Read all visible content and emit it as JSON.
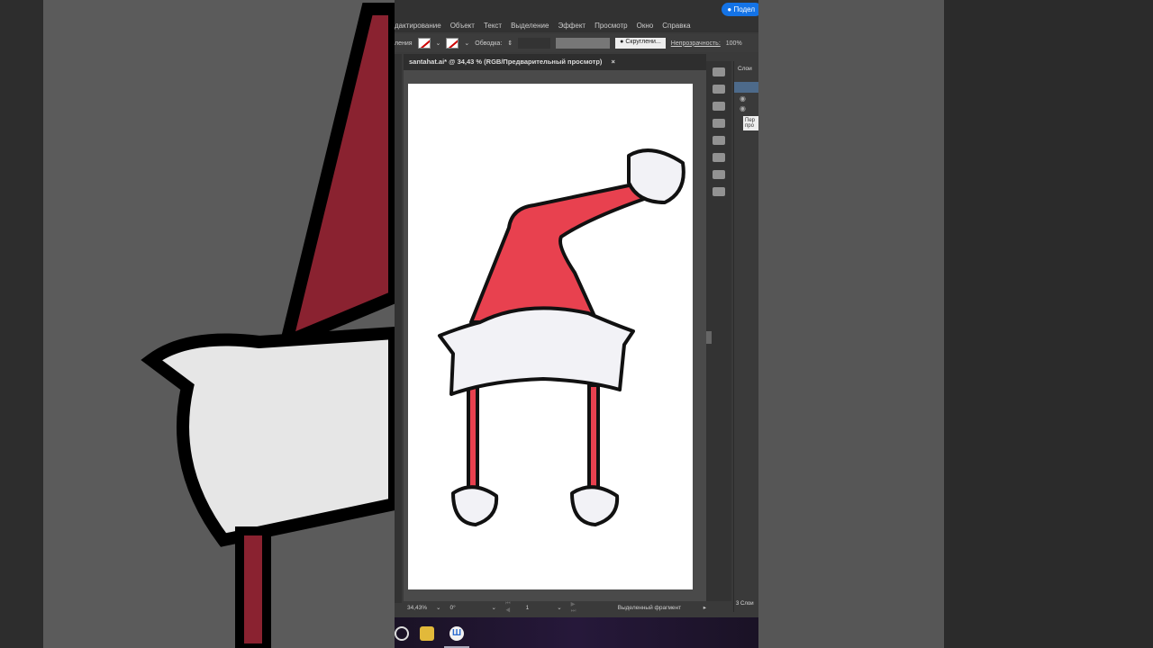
{
  "app": {
    "share_label": "Подел",
    "menu": [
      "дактирование",
      "Объект",
      "Текст",
      "Выделение",
      "Эффект",
      "Просмотр",
      "Окно",
      "Справка"
    ],
    "control": {
      "left_label": "ления",
      "stroke_label": "Обводка:",
      "brush_label": "Скруглени...",
      "opacity_label": "Непрозрачность:",
      "opacity_value": "100%"
    },
    "doc_tab": "santahat.ai* @ 34,43 % (RGB/Предварительный просмотр)",
    "doc_close": "×",
    "layers_panel": {
      "title": "Слои",
      "tooltip": "Пер\nпро",
      "count": "3 Слои"
    },
    "status": {
      "zoom": "34,43%",
      "rotation": "0°",
      "artboard": "1",
      "tool": "Выделенный фрагмент"
    }
  },
  "taskbar": {
    "icons": [
      "search-icon",
      "beer-mug-icon",
      "app-w-icon"
    ],
    "app_w_letter": "Ш"
  },
  "colors": {
    "accent": "#1473e6",
    "hat_red": "#e8414f",
    "fur": "#f2f2f6"
  }
}
